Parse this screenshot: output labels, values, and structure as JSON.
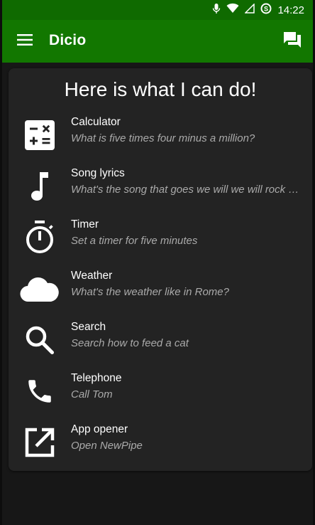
{
  "status_bar": {
    "time": "14:22",
    "icons": [
      "mic-icon",
      "wifi-icon",
      "signal-icon",
      "data-saver-icon"
    ]
  },
  "app_bar": {
    "title": "Dicio",
    "menu_icon": "hamburger-menu-icon",
    "action_icon": "chat-bubbles-icon",
    "background": "#127700"
  },
  "card": {
    "title": "Here is what I can do!",
    "skills": [
      {
        "name": "Calculator",
        "example": "What is five times four minus a million?",
        "icon": "calculator-icon"
      },
      {
        "name": "Song lyrics",
        "example": "What's the song that goes we will we will rock …",
        "icon": "music-note-icon"
      },
      {
        "name": "Timer",
        "example": "Set a timer for five minutes",
        "icon": "timer-icon"
      },
      {
        "name": "Weather",
        "example": "What's the weather like in Rome?",
        "icon": "cloud-icon"
      },
      {
        "name": "Search",
        "example": "Search how to feed a cat",
        "icon": "search-icon"
      },
      {
        "name": "Telephone",
        "example": "Call Tom",
        "icon": "phone-icon"
      },
      {
        "name": "App opener",
        "example": "Open NewPipe",
        "icon": "open-in-new-icon"
      }
    ]
  }
}
